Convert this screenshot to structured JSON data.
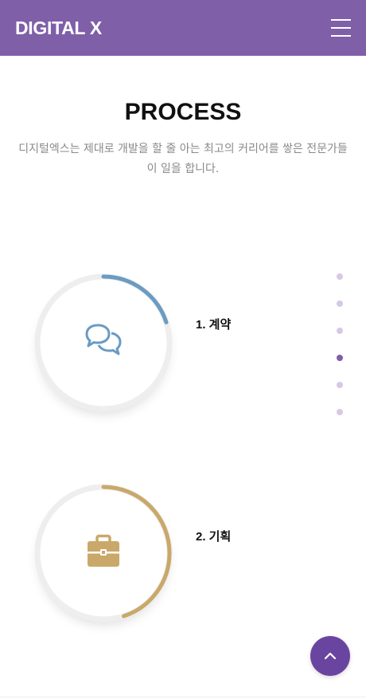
{
  "header": {
    "logo": "DIGITAL X",
    "menu_icon": "hamburger-icon",
    "background_color": "#7f5fa8"
  },
  "section": {
    "title": "PROCESS",
    "description": "디지털엑스는 제대로 개발을 할 줄 아는 최고의 커리어를 쌓은 전문가들이 일을 합니다."
  },
  "steps": [
    {
      "label": "1. 계약",
      "icon": "comments-icon",
      "color": "#6a9bc3",
      "progress": 0.2
    },
    {
      "label": "2. 기획",
      "icon": "briefcase-icon",
      "color": "#c9a86a",
      "progress": 0.45
    }
  ],
  "pagination": {
    "count": 6,
    "active_index": 3,
    "dot_color": "#d7c8e6",
    "active_color": "#7f5fa8"
  },
  "scroll_top": {
    "icon": "chevron-up-icon",
    "color": "#6a45a0"
  }
}
